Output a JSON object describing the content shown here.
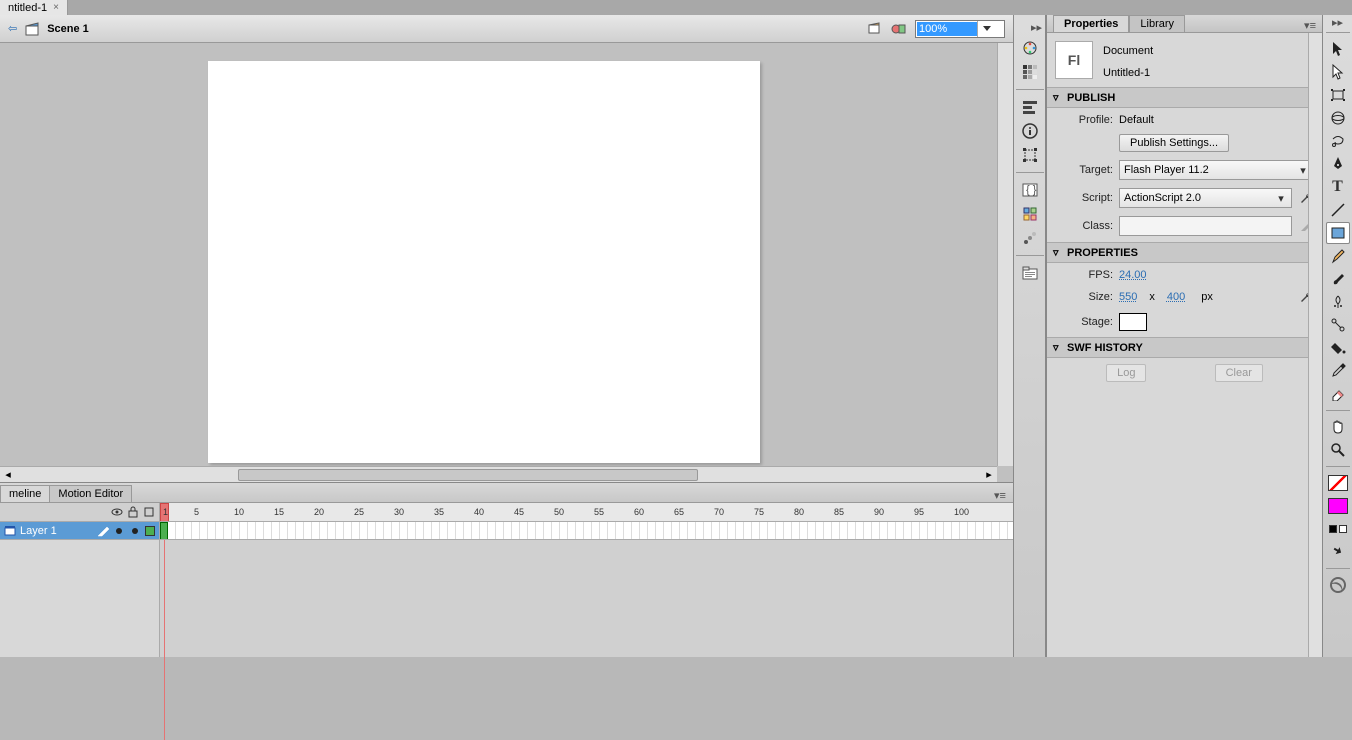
{
  "top_tab": {
    "file_name": "ntitled-1"
  },
  "scene": {
    "label": "Scene 1"
  },
  "zoom": {
    "value": "100%"
  },
  "timeline": {
    "tabs": [
      "meline",
      "Motion Editor"
    ],
    "layer": {
      "name": "Layer 1"
    },
    "ruler_marks": [
      "1",
      "5",
      "10",
      "15",
      "20",
      "25",
      "30",
      "35",
      "40",
      "45",
      "50",
      "55",
      "60",
      "65",
      "70",
      "75",
      "80",
      "85",
      "90",
      "95",
      "100"
    ]
  },
  "panel": {
    "tabs": [
      "Properties",
      "Library"
    ],
    "doc": {
      "kind": "Document",
      "name": "Untitled-1",
      "icon_text": "Fl"
    },
    "publish": {
      "title": "PUBLISH",
      "profile_label": "Profile:",
      "profile_value": "Default",
      "settings_btn": "Publish Settings...",
      "target_label": "Target:",
      "target_value": "Flash Player 11.2",
      "script_label": "Script:",
      "script_value": "ActionScript 2.0",
      "class_label": "Class:"
    },
    "properties": {
      "title": "PROPERTIES",
      "fps_label": "FPS:",
      "fps_value": "24.00",
      "size_label": "Size:",
      "width": "550",
      "x_sep": "x",
      "height": "400",
      "unit": "px",
      "stage_label": "Stage:"
    },
    "swf_history": {
      "title": "SWF HISTORY",
      "log_btn": "Log",
      "clear_btn": "Clear"
    }
  }
}
